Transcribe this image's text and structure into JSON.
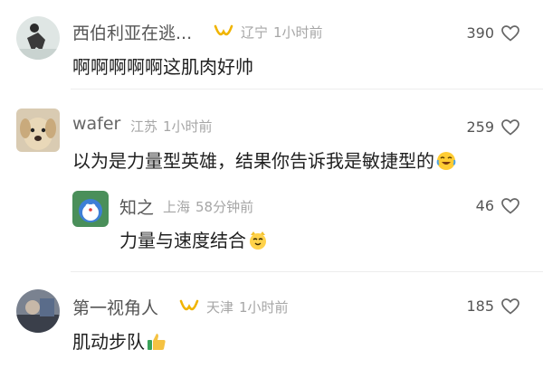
{
  "comments": [
    {
      "username": "西伯利亚在逃...",
      "location": "辽宁",
      "time": "1小时前",
      "text": "啊啊啊啊啊这肌肉好帅",
      "likes": "390",
      "has_badge": true
    },
    {
      "username": "wafer",
      "location": "江苏",
      "time": "1小时前",
      "text": "以为是力量型英雄，结果你告诉我是敏捷型的",
      "likes": "259",
      "has_badge": false,
      "emoji": "laughing-crying-emoji"
    },
    {
      "username": "知之",
      "location": "上海",
      "time": "58分钟前",
      "text": "力量与速度结合",
      "likes": "46",
      "has_badge": false,
      "is_reply": true,
      "emoji": "cat-face-emoji"
    },
    {
      "username": "第一视角人",
      "location": "天津",
      "time": "1小时前",
      "text": "肌动步队",
      "likes": "185",
      "has_badge": true,
      "emoji": "thumbs-up-emoji"
    }
  ],
  "colors": {
    "badge": "#f0b400",
    "meta": "#a6a6a6",
    "heart": "#666666"
  }
}
